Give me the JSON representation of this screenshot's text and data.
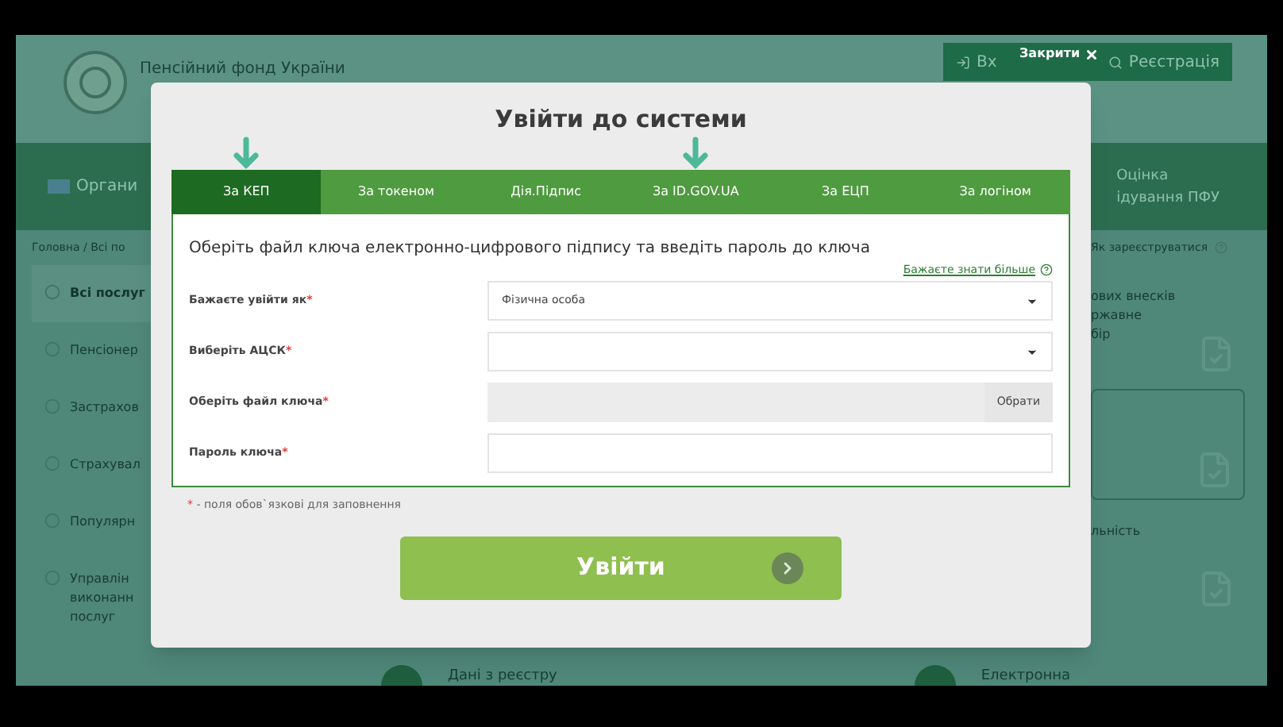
{
  "background_page": {
    "logo_text": "Пенсійний фонд України",
    "header_links": [
      {
        "kind": "login",
        "label": "Вх"
      },
      {
        "kind": "register",
        "label": "Реєстрація"
      }
    ],
    "nav_left": "Органи",
    "nav_right": [
      "Оцінка",
      "ідування ПФУ"
    ],
    "breadcrumb": "Головна / Всі по",
    "help_link": "Як зареєструватися",
    "sidebar": [
      {
        "label": "Всі послуг",
        "selected": true
      },
      {
        "label": "Пенсіонер",
        "selected": false
      },
      {
        "label": "Застрахов",
        "selected": false
      },
      {
        "label": "Страхувал",
        "selected": false
      },
      {
        "label": "Популярн",
        "selected": false
      },
      {
        "label": "Управлін виконанн послуг",
        "selected": false
      }
    ],
    "right_cards": [
      {
        "lines": [
          "ових внесків",
          "ржавне",
          "бір"
        ],
        "selected": false
      },
      {
        "selected": true
      },
      {
        "lines": [
          "льність"
        ],
        "selected": false
      }
    ],
    "bottom_items": [
      "Дані з реєстру",
      "Електронна"
    ]
  },
  "modal": {
    "close": "Закрити",
    "title": "Увійти до системи",
    "tabs": [
      {
        "label": "За КЕП",
        "selected": true,
        "arrow": true
      },
      {
        "label": "За токеном",
        "selected": false,
        "arrow": false
      },
      {
        "label": "Дія.Підпис",
        "selected": false,
        "arrow": false
      },
      {
        "label": "За ID.GOV.UA",
        "selected": false,
        "arrow": true
      },
      {
        "label": "За ЕЦП",
        "selected": false,
        "arrow": false
      },
      {
        "label": "За логіном",
        "selected": false,
        "arrow": false
      }
    ],
    "instruction": "Оберіть файл ключа електронно-цифрового підпису та введіть пароль до ключа",
    "more_link": "Бажаєте знати більше",
    "required_mark": "*",
    "fields": [
      {
        "kind": "select",
        "label": "Бажаєте увійти як",
        "value": "Фізична особа",
        "required": true
      },
      {
        "kind": "select",
        "label": "Виберіть АЦСК",
        "required": true
      },
      {
        "kind": "file",
        "label": "Оберіть файл ключа",
        "button": "Обрати",
        "required": true
      },
      {
        "kind": "password",
        "label": "Пароль ключа",
        "required": true
      }
    ],
    "required_note": "- поля обов`язкові для заповнення",
    "submit": "Увійти"
  }
}
